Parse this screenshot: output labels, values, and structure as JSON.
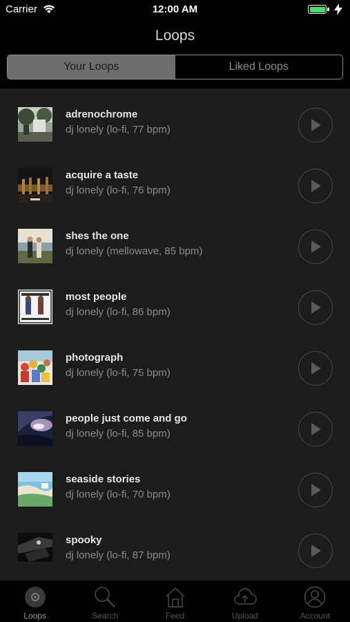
{
  "status": {
    "carrier": "Carrier",
    "time": "12:00 AM"
  },
  "nav": {
    "title": "Loops"
  },
  "segments": {
    "your": "Your Loops",
    "liked": "Liked Loops"
  },
  "loops": [
    {
      "title": "adrenochrome",
      "subtitle": "dj lonely (lo-fi, 77 bpm)"
    },
    {
      "title": "acquire a taste",
      "subtitle": "dj lonely (lo-fi, 76 bpm)"
    },
    {
      "title": "shes the one",
      "subtitle": "dj lonely (mellowave, 85 bpm)"
    },
    {
      "title": "most people",
      "subtitle": "dj lonely (lo-fi, 86 bpm)"
    },
    {
      "title": "photograph",
      "subtitle": "dj lonely (lo-fi, 75 bpm)"
    },
    {
      "title": "people just come and go",
      "subtitle": "dj lonely (lo-fi, 85 bpm)"
    },
    {
      "title": "seaside stories",
      "subtitle": "dj lonely (lo-fi, 70 bpm)"
    },
    {
      "title": "spooky",
      "subtitle": "dj lonely (lo-fi, 87 bpm)"
    }
  ],
  "tabs": {
    "loops": "Loops",
    "search": "Search",
    "feed": "Feed",
    "upload": "Upload",
    "account": "Account"
  },
  "colors": {
    "background": "#000000",
    "list": "#1c1c1c",
    "battery": "#4cd964"
  }
}
